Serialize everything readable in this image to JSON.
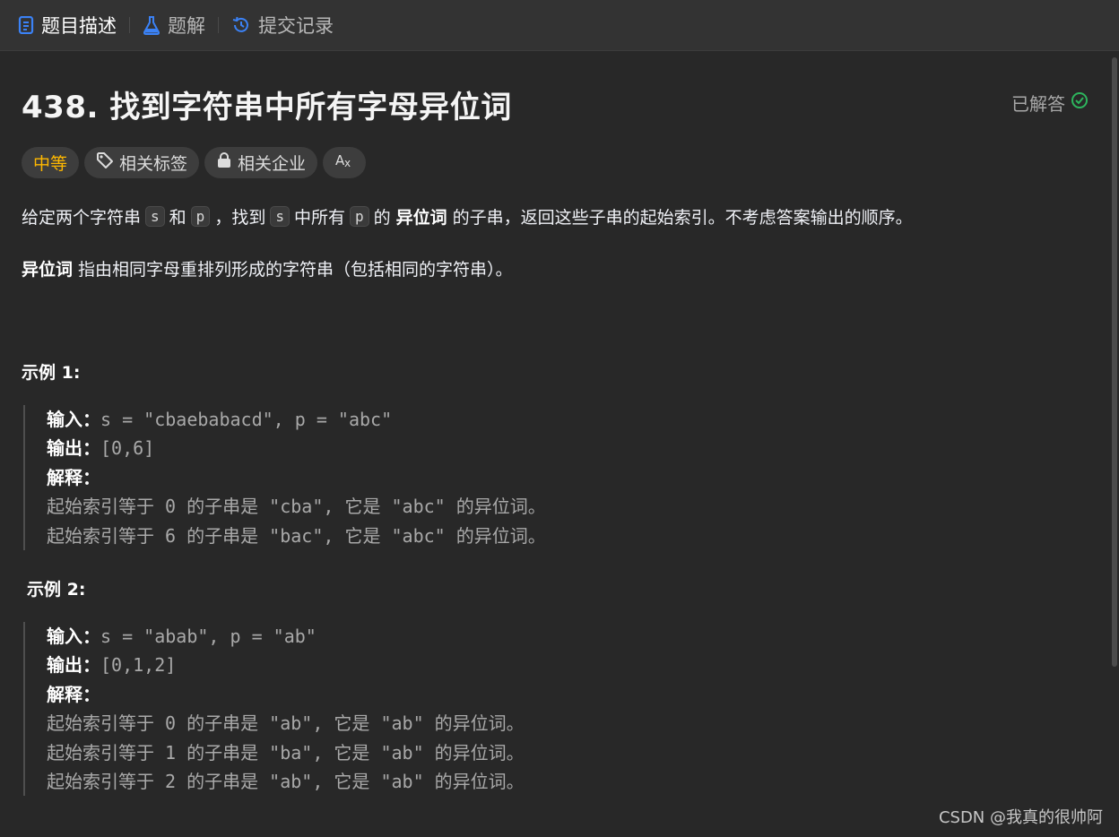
{
  "tabs": [
    {
      "label": "题目描述",
      "icon": "document-icon",
      "active": true
    },
    {
      "label": "题解",
      "icon": "flask-icon",
      "active": false
    },
    {
      "label": "提交记录",
      "icon": "history-icon",
      "active": false
    }
  ],
  "problem": {
    "title": "438. 找到字符串中所有字母异位词",
    "status": "已解答",
    "difficulty": "中等",
    "tags_label": "相关标签",
    "companies_label": "相关企业",
    "translate_icon_label": "Aあ"
  },
  "description": {
    "p1_a": "给定两个字符串",
    "code_s": "s",
    "p1_b": "和",
    "code_p": "p",
    "p1_c": "，找到",
    "p1_d": "中所有",
    "p1_e": "的",
    "p1_bold": "异位词",
    "p1_f": "的子串，返回这些子串的起始索引。不考虑答案输出的顺序。",
    "p2_bold": "异位词",
    "p2_text": "指由相同字母重排列形成的字符串（包括相同的字符串）。"
  },
  "examples": [
    {
      "title": "示例 1:",
      "input_label": "输入：",
      "input": "s = \"cbaebabacd\", p = \"abc\"",
      "output_label": "输出：",
      "output": "[0,6]",
      "explain_label": "解释：",
      "lines": [
        "起始索引等于 0 的子串是 \"cba\", 它是 \"abc\" 的异位词。",
        "起始索引等于 6 的子串是 \"bac\", 它是 \"abc\" 的异位词。"
      ]
    },
    {
      "title": "示例 2:",
      "input_label": "输入：",
      "input": "s = \"abab\", p = \"ab\"",
      "output_label": "输出：",
      "output": "[0,1,2]",
      "explain_label": "解释：",
      "lines": [
        "起始索引等于 0 的子串是 \"ab\", 它是 \"ab\" 的异位词。",
        "起始索引等于 1 的子串是 \"ba\", 它是 \"ab\" 的异位词。",
        "起始索引等于 2 的子串是 \"ab\", 它是 \"ab\" 的异位词。"
      ]
    }
  ],
  "watermark": "CSDN @我真的很帅阿",
  "colors": {
    "background": "#282828",
    "tabbar": "#333333",
    "accent_blue": "#3b82f6",
    "difficulty_medium": "#ffb800",
    "solved_green": "#2db55d"
  }
}
